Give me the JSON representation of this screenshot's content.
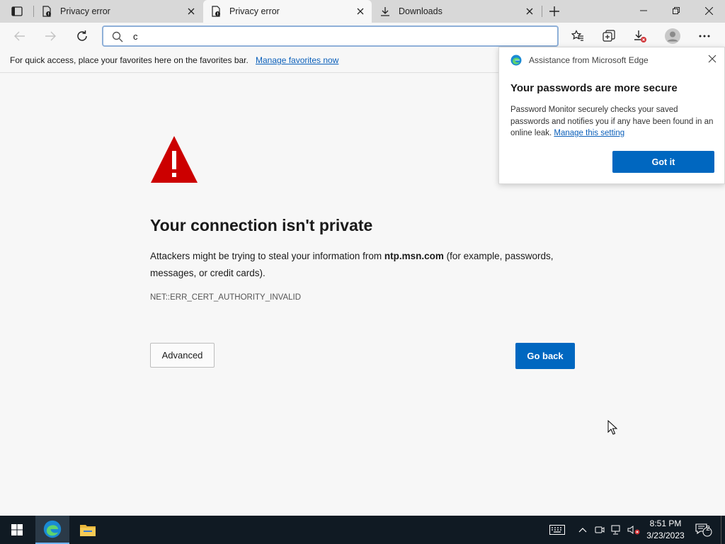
{
  "tabs": [
    {
      "label": "Privacy error",
      "active": false
    },
    {
      "label": "Privacy error",
      "active": true
    },
    {
      "label": "Downloads",
      "active": false
    }
  ],
  "address_bar": {
    "value": "c"
  },
  "favorites_bar": {
    "text": "For quick access, place your favorites here on the favorites bar.",
    "link": "Manage favorites now"
  },
  "error_page": {
    "title": "Your connection isn't private",
    "desc_before": "Attackers might be trying to steal your information from ",
    "domain": "ntp.msn.com",
    "desc_after": " (for example, passwords, messages, or credit cards).",
    "code": "NET::ERR_CERT_AUTHORITY_INVALID",
    "advanced_label": "Advanced",
    "go_back_label": "Go back"
  },
  "popup": {
    "header": "Assistance from Microsoft Edge",
    "title": "Your passwords are more secure",
    "body": "Password Monitor securely checks your saved passwords and notifies you if any have been found in an online leak.",
    "link": "Manage this setting",
    "button": "Got it"
  },
  "taskbar": {
    "time": "8:51 PM",
    "date": "3/23/2023",
    "notifications": "2"
  },
  "colors": {
    "accent": "#0067c0",
    "warning": "#cc0000",
    "taskbar": "#101a23"
  }
}
